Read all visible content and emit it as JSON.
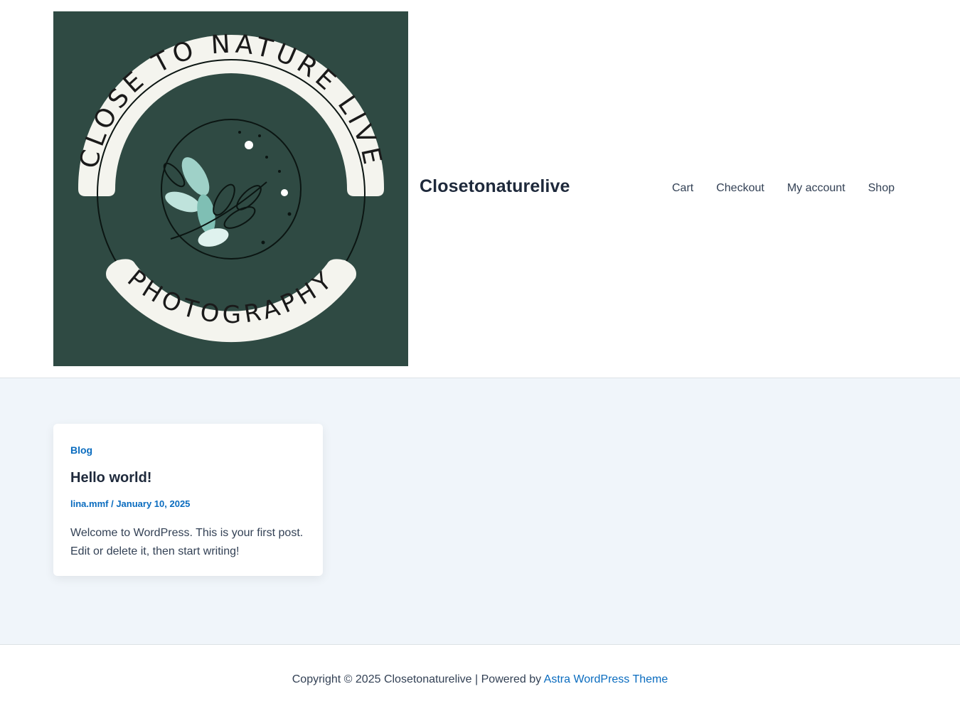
{
  "header": {
    "logo": {
      "top_arc_text": "CLOSE TO NATURE LIVE",
      "bottom_arc_text": "PHOTOGRAPHY",
      "bg_color": "#2f4a43",
      "banner_color": "#f4f4ee"
    },
    "site_title": "Closetonaturelive",
    "nav": [
      {
        "label": "Cart"
      },
      {
        "label": "Checkout"
      },
      {
        "label": "My account"
      },
      {
        "label": "Shop"
      }
    ]
  },
  "posts": [
    {
      "category": "Blog",
      "title": "Hello world!",
      "author": "lina.mmf",
      "meta_separator": "/",
      "date": "January 10, 2025",
      "excerpt": "Welcome to WordPress. This is your first post. Edit or delete it, then start writing!"
    }
  ],
  "footer": {
    "prefix": "Copyright © 2025 Closetonaturelive | Powered by ",
    "link_label": "Astra WordPress Theme"
  },
  "colors": {
    "accent": "#0a6cbf",
    "content_bg": "#f0f5fa",
    "heading": "#1e293b"
  }
}
